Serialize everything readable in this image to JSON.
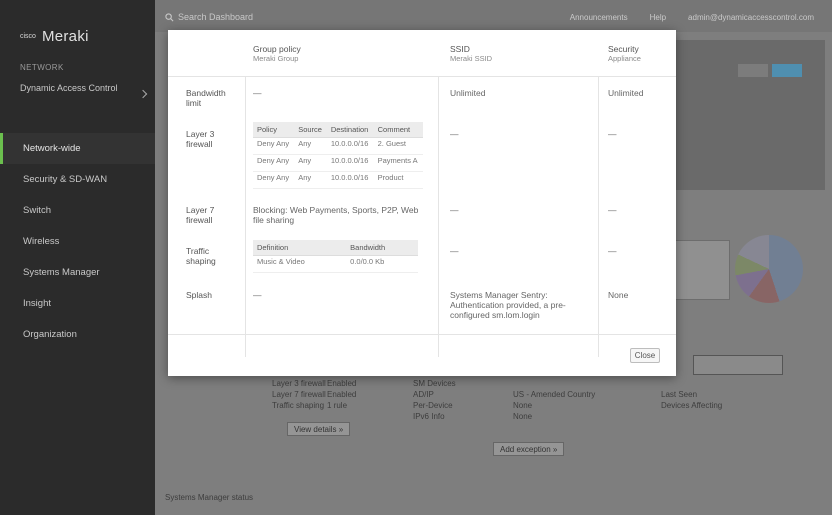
{
  "sidebar": {
    "logo_mark": "cisco",
    "logo_text": "Meraki",
    "network_label": "NETWORK",
    "network_name": "Dynamic Access Control",
    "items": [
      {
        "label": "Network-wide",
        "active": true
      },
      {
        "label": "Security & SD-WAN",
        "active": false
      },
      {
        "label": "Switch",
        "active": false
      },
      {
        "label": "Wireless",
        "active": false
      },
      {
        "label": "Systems Manager",
        "active": false
      },
      {
        "label": "Insight",
        "active": false
      },
      {
        "label": "Organization",
        "active": false
      }
    ],
    "accent_color": "#6bbf4e"
  },
  "topbar": {
    "search_placeholder": "Search Dashboard",
    "announcements": "Announcements",
    "help": "Help",
    "account": "admin@dynamicaccesscontrol.com"
  },
  "background": {
    "stats_rows": [
      {
        "label": "Layer 3 firewall",
        "value": "Enabled"
      },
      {
        "label": "Layer 7 firewall",
        "value": "Enabled"
      },
      {
        "label": "Traffic shaping",
        "value": "1 rule"
      }
    ],
    "view_details_label": "View details »",
    "add_exception_label": "Add exception »",
    "mid_rows": [
      "SM Devices",
      "AD/IP",
      "Per-Device",
      "IPv6 Info"
    ],
    "mid_values": [
      "US - Amended Country",
      "None",
      "None"
    ],
    "right_rows": [
      "Last Seen",
      "Devices Affecting"
    ],
    "footer": "Systems Manager status"
  },
  "modal": {
    "columns": [
      {
        "title": "Group policy",
        "subtitle": "Meraki Group"
      },
      {
        "title": "SSID",
        "subtitle": "Meraki SSID"
      },
      {
        "title": "Security",
        "subtitle": "Appliance"
      }
    ],
    "rows": {
      "bandwidth": {
        "label": "Bandwidth limit",
        "group": "—",
        "ssid": "Unlimited",
        "security": "Unlimited"
      },
      "layer3": {
        "label": "Layer 3 firewall",
        "table_headers": [
          "Policy",
          "Source",
          "Destination",
          "Comment"
        ],
        "table_rows": [
          [
            "Deny Any",
            "Any",
            "10.0.0.0/16",
            "2. Guest"
          ],
          [
            "Deny Any",
            "Any",
            "10.0.0.0/16",
            "Payments A"
          ],
          [
            "Deny Any",
            "Any",
            "10.0.0.0/16",
            "Product"
          ]
        ],
        "ssid": "—",
        "security": "—"
      },
      "layer7": {
        "label": "Layer 7 firewall",
        "group": "Blocking: Web Payments, Sports, P2P, Web file sharing",
        "ssid": "—",
        "security": "—"
      },
      "shaping": {
        "label": "Traffic shaping",
        "table_headers": [
          "Definition",
          "Bandwidth"
        ],
        "table_rows": [
          [
            "Music & Video",
            "0.0/0.0 Kb"
          ]
        ],
        "ssid": "—",
        "security": "—"
      },
      "splash": {
        "label": "Splash",
        "group": "—",
        "ssid": "Systems Manager Sentry: Authentication provided, a pre-configured sm.lom.login",
        "security": "None"
      }
    },
    "close_label": "Close"
  }
}
